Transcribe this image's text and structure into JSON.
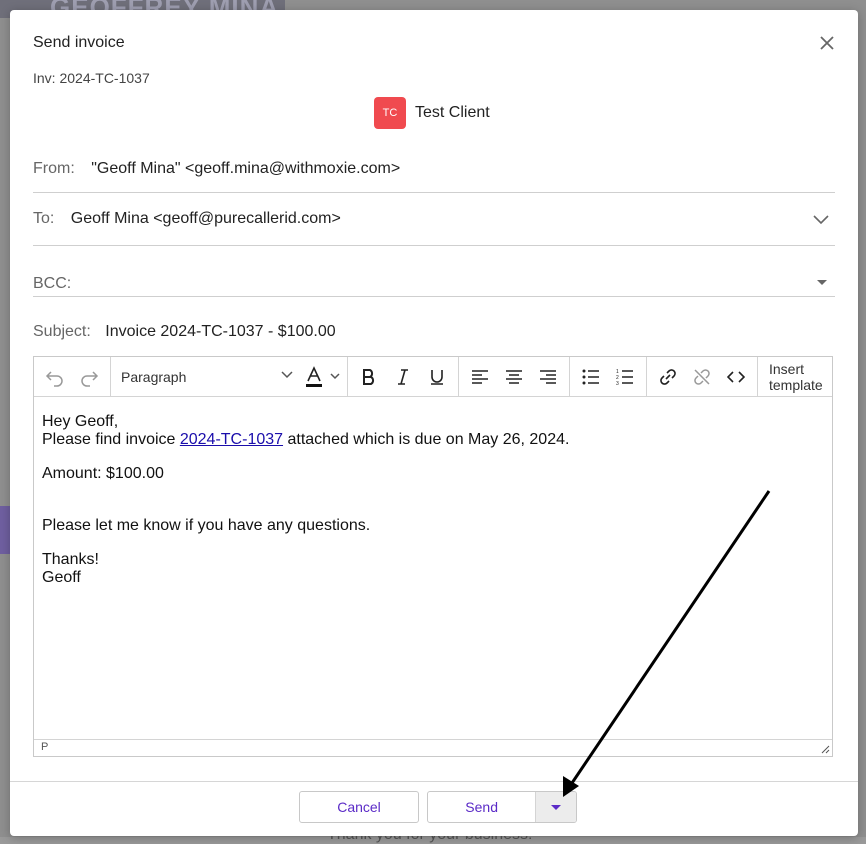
{
  "background": {
    "header_text": "GEOFFREY MINA",
    "footer_text": "Thank you for your business!"
  },
  "modal": {
    "title": "Send invoice",
    "invoice_ref": "Inv: 2024-TC-1037",
    "client": {
      "initials": "TC",
      "name": "Test Client",
      "avatar_color": "#f04a4f"
    },
    "from": {
      "label": "From:",
      "value": "\"Geoff Mina\" <geoff.mina@withmoxie.com>"
    },
    "to": {
      "label": "To:",
      "value": "Geoff Mina <geoff@purecallerid.com>"
    },
    "bcc": {
      "label": "BCC:"
    },
    "subject": {
      "label": "Subject:",
      "value": "Invoice 2024-TC-1037 - $100.00"
    },
    "toolbar": {
      "paragraph": "Paragraph",
      "insert_template": "Insert template"
    },
    "body": {
      "greeting": "Hey Geoff,",
      "line1_before": "Please find invoice ",
      "line1_link": "2024-TC-1037",
      "line1_after": " attached which is due on May 26, 2024.",
      "amount": "Amount: $100.00",
      "questions": "Please let me know if you have any questions.",
      "thanks": "Thanks!",
      "signature": "Geoff"
    },
    "status_path": "P",
    "buttons": {
      "cancel": "Cancel",
      "send": "Send"
    },
    "accent_color": "#5b2bc7"
  }
}
